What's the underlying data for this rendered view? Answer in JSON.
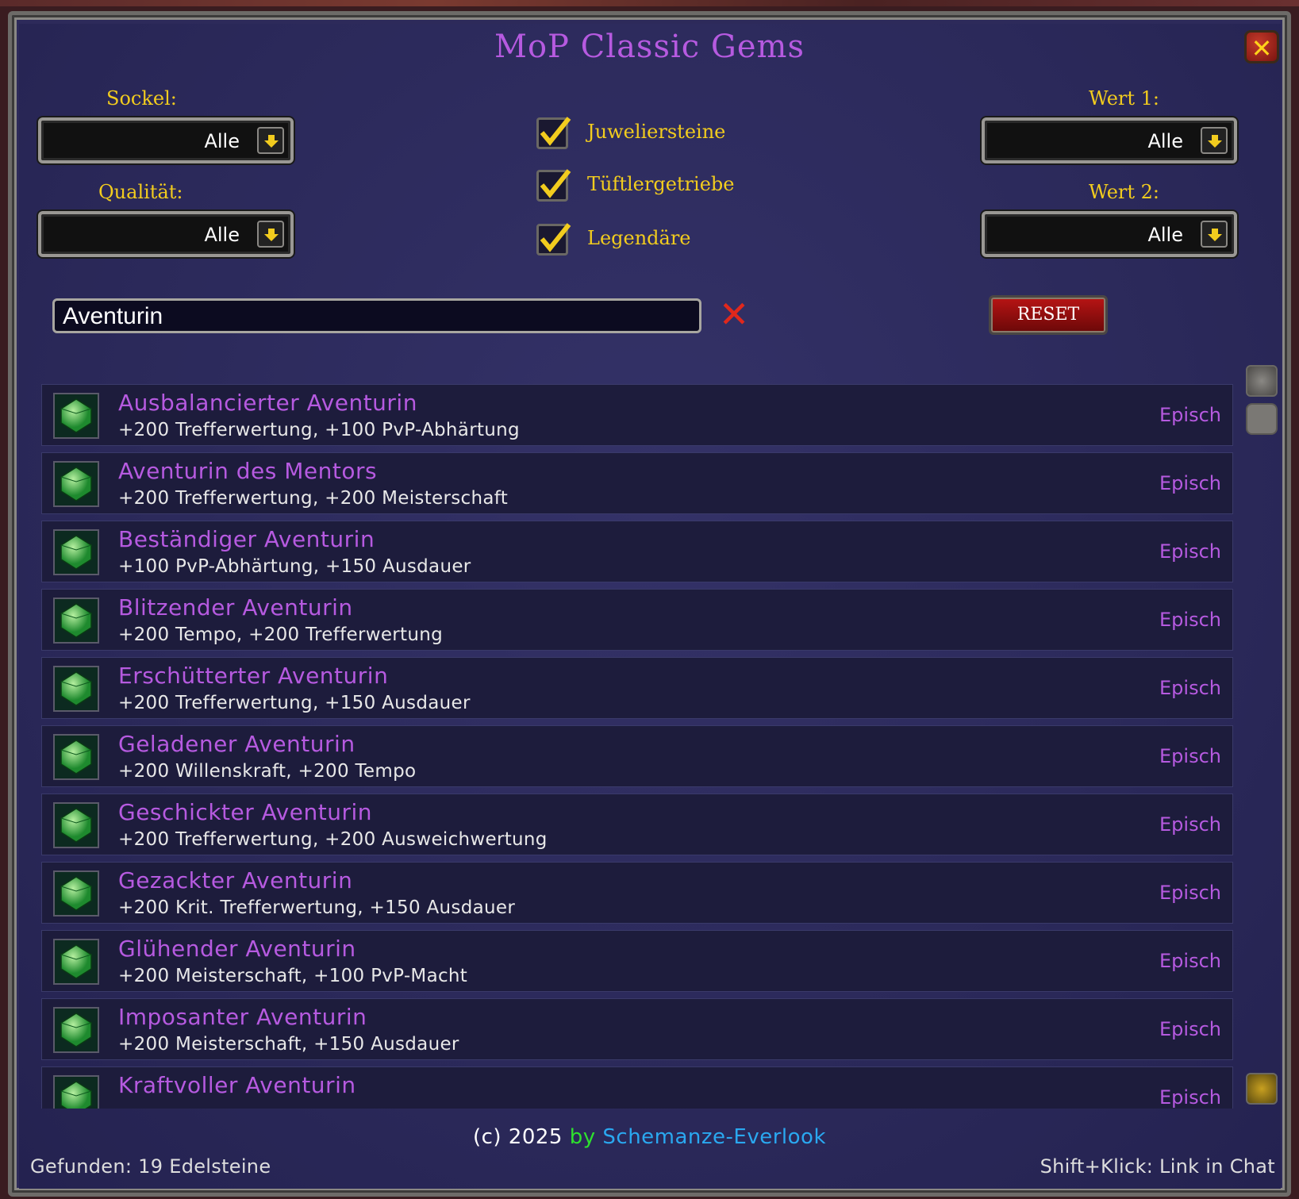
{
  "window": {
    "title": "MoP Classic Gems",
    "close_icon": "close-icon"
  },
  "filters": {
    "sockel": {
      "label": "Sockel:",
      "value": "Alle"
    },
    "qualitaet": {
      "label": "Qualität:",
      "value": "Alle"
    },
    "wert1": {
      "label": "Wert 1:",
      "value": "Alle"
    },
    "wert2": {
      "label": "Wert 2:",
      "value": "Alle"
    }
  },
  "checkboxes": [
    {
      "label": "Juweliersteine",
      "checked": true
    },
    {
      "label": "Tüftlergetriebe",
      "checked": true
    },
    {
      "label": "Legendäre",
      "checked": true
    }
  ],
  "search": {
    "value": "Aventurin"
  },
  "reset_label": "RESET",
  "gems": [
    {
      "name": "Ausbalancierter Aventurin",
      "stats": "+200 Trefferwertung, +100 PvP-Abhärtung",
      "quality": "Episch"
    },
    {
      "name": "Aventurin des Mentors",
      "stats": "+200 Trefferwertung, +200 Meisterschaft",
      "quality": "Episch"
    },
    {
      "name": "Beständiger Aventurin",
      "stats": "+100 PvP-Abhärtung, +150 Ausdauer",
      "quality": "Episch"
    },
    {
      "name": "Blitzender Aventurin",
      "stats": "+200 Tempo, +200 Trefferwertung",
      "quality": "Episch"
    },
    {
      "name": "Erschütterter Aventurin",
      "stats": "+200 Trefferwertung, +150 Ausdauer",
      "quality": "Episch"
    },
    {
      "name": "Geladener Aventurin",
      "stats": "+200 Willenskraft, +200 Tempo",
      "quality": "Episch"
    },
    {
      "name": "Geschickter Aventurin",
      "stats": "+200 Trefferwertung, +200 Ausweichwertung",
      "quality": "Episch"
    },
    {
      "name": "Gezackter Aventurin",
      "stats": "+200 Krit. Trefferwertung, +150 Ausdauer",
      "quality": "Episch"
    },
    {
      "name": "Glühender Aventurin",
      "stats": "+200 Meisterschaft, +100 PvP-Macht",
      "quality": "Episch"
    },
    {
      "name": "Imposanter Aventurin",
      "stats": "+200 Meisterschaft, +150 Ausdauer",
      "quality": "Episch"
    },
    {
      "name": "Kraftvoller Aventurin",
      "stats": "",
      "quality": "Episch"
    }
  ],
  "footer": {
    "credit_prefix": "(c) 2025",
    "credit_by": "by",
    "credit_author": "Schemanze-Everlook",
    "found": "Gefunden: 19 Edelsteine",
    "hint": "Shift+Klick: Link in Chat"
  },
  "colors": {
    "epic": "#b65ae0",
    "label_gold": "#f2cc1e",
    "panel_bg": "#2d2a5a"
  }
}
